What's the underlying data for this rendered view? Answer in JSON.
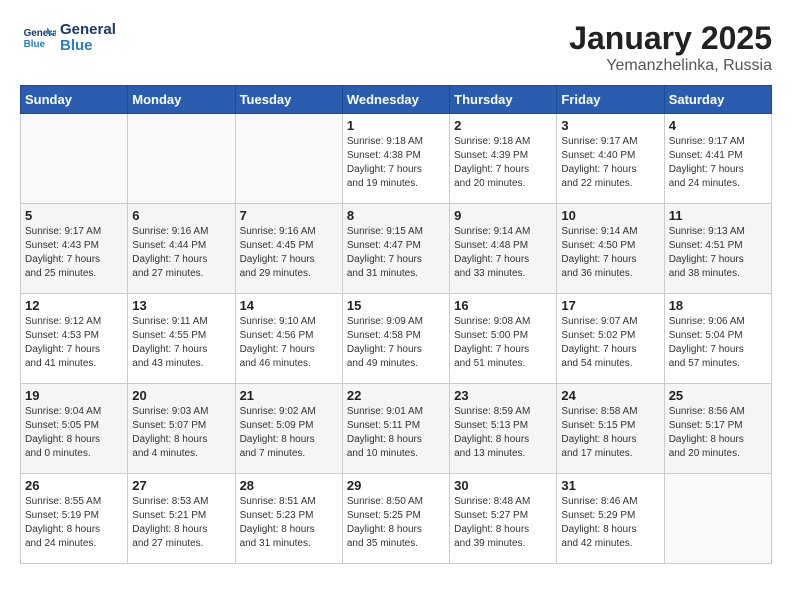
{
  "header": {
    "logo_line1": "General",
    "logo_line2": "Blue",
    "title": "January 2025",
    "subtitle": "Yemanzhelinka, Russia"
  },
  "days_of_week": [
    "Sunday",
    "Monday",
    "Tuesday",
    "Wednesday",
    "Thursday",
    "Friday",
    "Saturday"
  ],
  "weeks": [
    [
      {
        "day": "",
        "info": ""
      },
      {
        "day": "",
        "info": ""
      },
      {
        "day": "",
        "info": ""
      },
      {
        "day": "1",
        "info": "Sunrise: 9:18 AM\nSunset: 4:38 PM\nDaylight: 7 hours\nand 19 minutes."
      },
      {
        "day": "2",
        "info": "Sunrise: 9:18 AM\nSunset: 4:39 PM\nDaylight: 7 hours\nand 20 minutes."
      },
      {
        "day": "3",
        "info": "Sunrise: 9:17 AM\nSunset: 4:40 PM\nDaylight: 7 hours\nand 22 minutes."
      },
      {
        "day": "4",
        "info": "Sunrise: 9:17 AM\nSunset: 4:41 PM\nDaylight: 7 hours\nand 24 minutes."
      }
    ],
    [
      {
        "day": "5",
        "info": "Sunrise: 9:17 AM\nSunset: 4:43 PM\nDaylight: 7 hours\nand 25 minutes."
      },
      {
        "day": "6",
        "info": "Sunrise: 9:16 AM\nSunset: 4:44 PM\nDaylight: 7 hours\nand 27 minutes."
      },
      {
        "day": "7",
        "info": "Sunrise: 9:16 AM\nSunset: 4:45 PM\nDaylight: 7 hours\nand 29 minutes."
      },
      {
        "day": "8",
        "info": "Sunrise: 9:15 AM\nSunset: 4:47 PM\nDaylight: 7 hours\nand 31 minutes."
      },
      {
        "day": "9",
        "info": "Sunrise: 9:14 AM\nSunset: 4:48 PM\nDaylight: 7 hours\nand 33 minutes."
      },
      {
        "day": "10",
        "info": "Sunrise: 9:14 AM\nSunset: 4:50 PM\nDaylight: 7 hours\nand 36 minutes."
      },
      {
        "day": "11",
        "info": "Sunrise: 9:13 AM\nSunset: 4:51 PM\nDaylight: 7 hours\nand 38 minutes."
      }
    ],
    [
      {
        "day": "12",
        "info": "Sunrise: 9:12 AM\nSunset: 4:53 PM\nDaylight: 7 hours\nand 41 minutes."
      },
      {
        "day": "13",
        "info": "Sunrise: 9:11 AM\nSunset: 4:55 PM\nDaylight: 7 hours\nand 43 minutes."
      },
      {
        "day": "14",
        "info": "Sunrise: 9:10 AM\nSunset: 4:56 PM\nDaylight: 7 hours\nand 46 minutes."
      },
      {
        "day": "15",
        "info": "Sunrise: 9:09 AM\nSunset: 4:58 PM\nDaylight: 7 hours\nand 49 minutes."
      },
      {
        "day": "16",
        "info": "Sunrise: 9:08 AM\nSunset: 5:00 PM\nDaylight: 7 hours\nand 51 minutes."
      },
      {
        "day": "17",
        "info": "Sunrise: 9:07 AM\nSunset: 5:02 PM\nDaylight: 7 hours\nand 54 minutes."
      },
      {
        "day": "18",
        "info": "Sunrise: 9:06 AM\nSunset: 5:04 PM\nDaylight: 7 hours\nand 57 minutes."
      }
    ],
    [
      {
        "day": "19",
        "info": "Sunrise: 9:04 AM\nSunset: 5:05 PM\nDaylight: 8 hours\nand 0 minutes."
      },
      {
        "day": "20",
        "info": "Sunrise: 9:03 AM\nSunset: 5:07 PM\nDaylight: 8 hours\nand 4 minutes."
      },
      {
        "day": "21",
        "info": "Sunrise: 9:02 AM\nSunset: 5:09 PM\nDaylight: 8 hours\nand 7 minutes."
      },
      {
        "day": "22",
        "info": "Sunrise: 9:01 AM\nSunset: 5:11 PM\nDaylight: 8 hours\nand 10 minutes."
      },
      {
        "day": "23",
        "info": "Sunrise: 8:59 AM\nSunset: 5:13 PM\nDaylight: 8 hours\nand 13 minutes."
      },
      {
        "day": "24",
        "info": "Sunrise: 8:58 AM\nSunset: 5:15 PM\nDaylight: 8 hours\nand 17 minutes."
      },
      {
        "day": "25",
        "info": "Sunrise: 8:56 AM\nSunset: 5:17 PM\nDaylight: 8 hours\nand 20 minutes."
      }
    ],
    [
      {
        "day": "26",
        "info": "Sunrise: 8:55 AM\nSunset: 5:19 PM\nDaylight: 8 hours\nand 24 minutes."
      },
      {
        "day": "27",
        "info": "Sunrise: 8:53 AM\nSunset: 5:21 PM\nDaylight: 8 hours\nand 27 minutes."
      },
      {
        "day": "28",
        "info": "Sunrise: 8:51 AM\nSunset: 5:23 PM\nDaylight: 8 hours\nand 31 minutes."
      },
      {
        "day": "29",
        "info": "Sunrise: 8:50 AM\nSunset: 5:25 PM\nDaylight: 8 hours\nand 35 minutes."
      },
      {
        "day": "30",
        "info": "Sunrise: 8:48 AM\nSunset: 5:27 PM\nDaylight: 8 hours\nand 39 minutes."
      },
      {
        "day": "31",
        "info": "Sunrise: 8:46 AM\nSunset: 5:29 PM\nDaylight: 8 hours\nand 42 minutes."
      },
      {
        "day": "",
        "info": ""
      }
    ]
  ]
}
